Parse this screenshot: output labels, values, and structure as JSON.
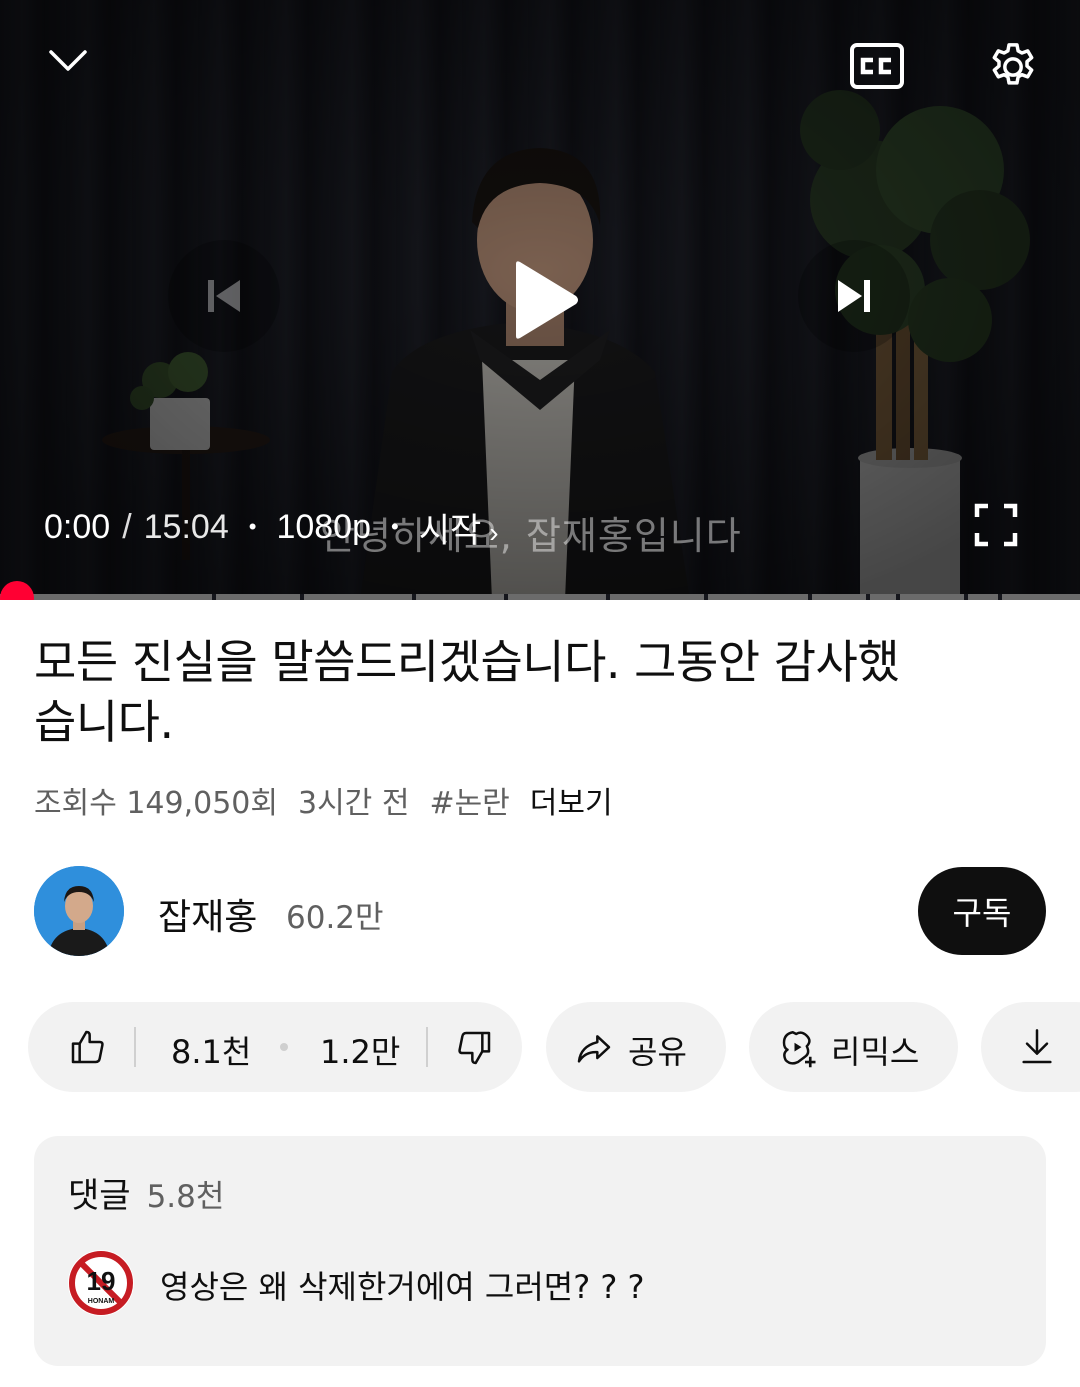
{
  "player": {
    "current_time": "0:00",
    "separator": "/",
    "duration": "15:04",
    "quality": "1080p",
    "chapter": "시작",
    "caption": "안녕하세요, 잡재홍입니다",
    "progress_fraction": 0.0,
    "icons": [
      "chevron-down-icon",
      "closed-captions-icon",
      "settings-gear-icon",
      "previous-icon",
      "play-icon",
      "next-icon",
      "fullscreen-icon"
    ]
  },
  "video": {
    "title": "모든 진실을 말씀드리겠습니다. 그동안 감사했습니다.",
    "views": "조회수 149,050회",
    "age": "3시간 전",
    "hashtag": "#논란",
    "more": "더보기"
  },
  "channel": {
    "name": "잡재홍",
    "subscribers": "60.2만",
    "subscribe_label": "구독"
  },
  "actions": {
    "likes": "8.1천",
    "dislikes": "1.2만",
    "share": "공유",
    "remix": "리믹스"
  },
  "comments": {
    "label": "댓글",
    "count": "5.8천",
    "top_comment": "영상은 왜 삭제한거에여 그러면? ? ?",
    "top_avatar_text": "19",
    "top_avatar_subtext": "HONAM"
  },
  "colors": {
    "accent_red": "#ff0033",
    "pill_bg": "#f2f2f2",
    "subscribe_bg": "#0f0f0f"
  }
}
